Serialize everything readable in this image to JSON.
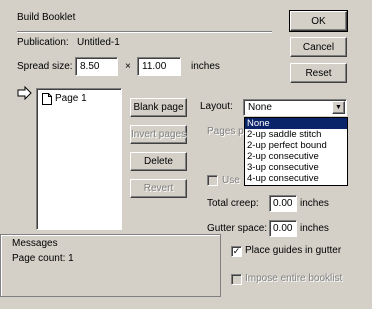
{
  "title": "Build Booklet",
  "publication": {
    "label": "Publication:",
    "value": "Untitled-1"
  },
  "spread_size": {
    "label": "Spread size:",
    "width": "8.50",
    "times": "×",
    "height": "11.00",
    "unit": "inches"
  },
  "buttons": {
    "ok": "OK",
    "cancel": "Cancel",
    "reset": "Reset",
    "blank_page": "Blank page",
    "invert_pages": "Invert pages",
    "delete": "Delete",
    "revert": "Revert"
  },
  "pages": {
    "items": [
      "Page 1"
    ]
  },
  "layout": {
    "label": "Layout:",
    "selected": "None",
    "options": [
      "None",
      "2-up saddle stitch",
      "2-up perfect bound",
      "2-up consecutive",
      "3-up consecutive",
      "4-up consecutive"
    ],
    "hidden_label": "Pages p",
    "use_label": "Use"
  },
  "creep": {
    "label": "Total creep:",
    "value": "0.00",
    "unit": "inches"
  },
  "gutter": {
    "label": "Gutter space:",
    "value": "0.00",
    "unit": "inches"
  },
  "messages": {
    "label": "Messages",
    "text": "Page count: 1"
  },
  "options": {
    "place_guides": {
      "label": "Place guides in gutter",
      "checked": "✓"
    },
    "impose_entire": {
      "label": "Impose entire booklist",
      "checked": ""
    }
  }
}
